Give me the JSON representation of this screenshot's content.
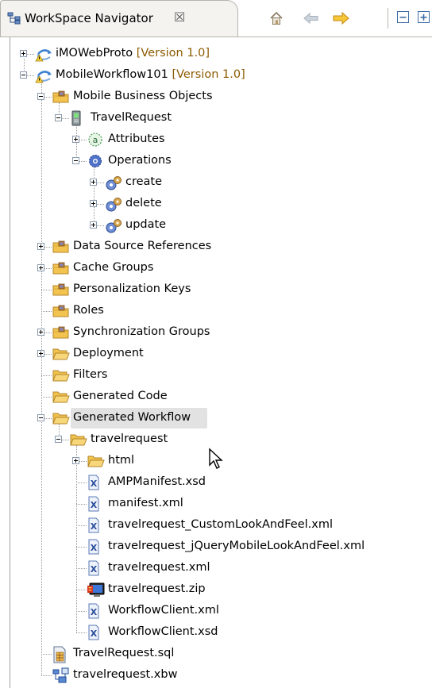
{
  "view": {
    "title": "WorkSpace Navigator",
    "close_symbol": "☒",
    "toolbar": [
      {
        "name": "home-icon"
      },
      {
        "name": "back-arrow-icon"
      },
      {
        "name": "forward-arrow-icon"
      },
      {
        "name": "collapse-all-icon"
      },
      {
        "name": "link-editor-icon"
      }
    ]
  },
  "tree": [
    {
      "label": "iMOWebProto",
      "version": "[Version 1.0]",
      "icon": "project-warning-icon",
      "depth": 0,
      "expander": "plus"
    },
    {
      "label": "MobileWorkflow101",
      "version": "[Version 1.0]",
      "icon": "project-warning-icon",
      "depth": 0,
      "expander": "minus"
    },
    {
      "label": "Mobile Business Objects",
      "icon": "folder-package-icon",
      "depth": 1,
      "expander": "minus"
    },
    {
      "label": "TravelRequest",
      "icon": "mobile-business-object-icon",
      "depth": 2,
      "expander": "minus"
    },
    {
      "label": "Attributes",
      "icon": "attributes-icon",
      "depth": 3,
      "expander": "plus"
    },
    {
      "label": "Operations",
      "icon": "operations-icon",
      "depth": 3,
      "expander": "minus"
    },
    {
      "label": "create",
      "icon": "operation-icon",
      "depth": 4,
      "expander": "plus"
    },
    {
      "label": "delete",
      "icon": "operation-icon",
      "depth": 4,
      "expander": "plus"
    },
    {
      "label": "update",
      "icon": "operation-icon",
      "depth": 4,
      "expander": "plus"
    },
    {
      "label": "Data Source References",
      "icon": "folder-package-icon",
      "depth": 1,
      "expander": "plus"
    },
    {
      "label": "Cache Groups",
      "icon": "folder-package-icon",
      "depth": 1,
      "expander": "plus"
    },
    {
      "label": "Personalization Keys",
      "icon": "folder-package-icon",
      "depth": 1,
      "expander": ""
    },
    {
      "label": "Roles",
      "icon": "folder-package-icon",
      "depth": 1,
      "expander": ""
    },
    {
      "label": "Synchronization Groups",
      "icon": "folder-package-icon",
      "depth": 1,
      "expander": "plus"
    },
    {
      "label": "Deployment",
      "icon": "folder-open-icon",
      "depth": 1,
      "expander": "plus"
    },
    {
      "label": "Filters",
      "icon": "folder-open-icon",
      "depth": 1,
      "expander": ""
    },
    {
      "label": "Generated Code",
      "icon": "folder-open-icon",
      "depth": 1,
      "expander": ""
    },
    {
      "label": "Generated Workflow",
      "icon": "folder-open-icon",
      "depth": 1,
      "expander": "minus",
      "selected": true
    },
    {
      "label": "travelrequest",
      "icon": "folder-open-icon",
      "depth": 2,
      "expander": "minus"
    },
    {
      "label": "html",
      "icon": "folder-open-icon",
      "depth": 3,
      "expander": "plus"
    },
    {
      "label": "AMPManifest.xsd",
      "icon": "xml-file-icon",
      "depth": 3,
      "expander": ""
    },
    {
      "label": "manifest.xml",
      "icon": "xml-file-icon",
      "depth": 3,
      "expander": ""
    },
    {
      "label": "travelrequest_CustomLookAndFeel.xml",
      "icon": "xml-file-icon",
      "depth": 3,
      "expander": ""
    },
    {
      "label": "travelrequest_jQueryMobileLookAndFeel.xml",
      "icon": "xml-file-icon",
      "depth": 3,
      "expander": ""
    },
    {
      "label": "travelrequest.xml",
      "icon": "xml-file-icon",
      "depth": 3,
      "expander": ""
    },
    {
      "label": "travelrequest.zip",
      "icon": "zip-file-icon",
      "depth": 3,
      "expander": ""
    },
    {
      "label": "WorkflowClient.xml",
      "icon": "xml-file-icon",
      "depth": 3,
      "expander": ""
    },
    {
      "label": "WorkflowClient.xsd",
      "icon": "xml-file-icon",
      "depth": 3,
      "expander": ""
    },
    {
      "label": "TravelRequest.sql",
      "icon": "sql-file-icon",
      "depth": 1,
      "expander": ""
    },
    {
      "label": "travelrequest.xbw",
      "icon": "workflow-file-icon",
      "depth": 1,
      "expander": ""
    }
  ],
  "colors": {
    "version": "#8c5a00",
    "selection": "#e2e2e2",
    "folder": "#f2c44f",
    "xml": "#2a4d9a"
  }
}
